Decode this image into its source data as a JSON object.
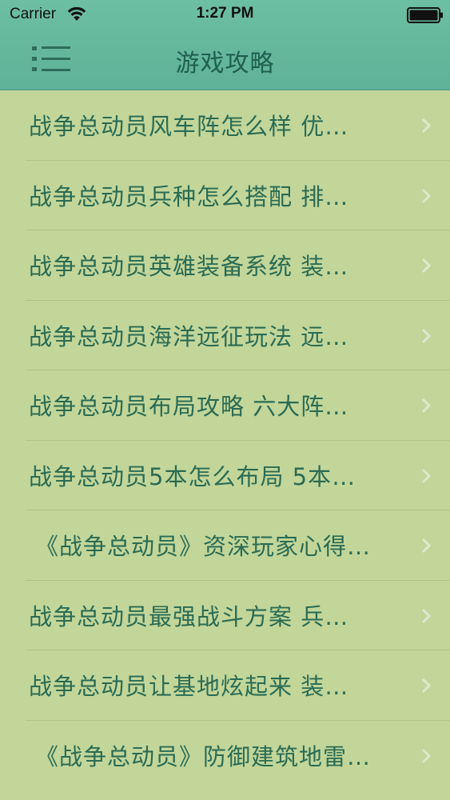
{
  "status": {
    "carrier": "Carrier",
    "time": "1:27 PM"
  },
  "nav": {
    "title": "游戏攻略",
    "menu_icon": "menu-list-icon"
  },
  "list": {
    "items": [
      {
        "label": "战争总动员风车阵怎么样 优…"
      },
      {
        "label": "战争总动员兵种怎么搭配 排…"
      },
      {
        "label": "战争总动员英雄装备系统 装…"
      },
      {
        "label": "战争总动员海洋远征玩法 远…"
      },
      {
        "label": "战争总动员布局攻略 六大阵…"
      },
      {
        "label": "战争总动员5本怎么布局 5本…"
      },
      {
        "label": "《战争总动员》资深玩家心得…"
      },
      {
        "label": "战争总动员最强战斗方案 兵…"
      },
      {
        "label": "战争总动员让基地炫起来 装…"
      },
      {
        "label": "《战争总动员》防御建筑地雷…"
      }
    ]
  },
  "colors": {
    "header": "#5fb197",
    "background": "#c2d69a",
    "text": "#2a6b53",
    "title": "#1f5f4d"
  }
}
